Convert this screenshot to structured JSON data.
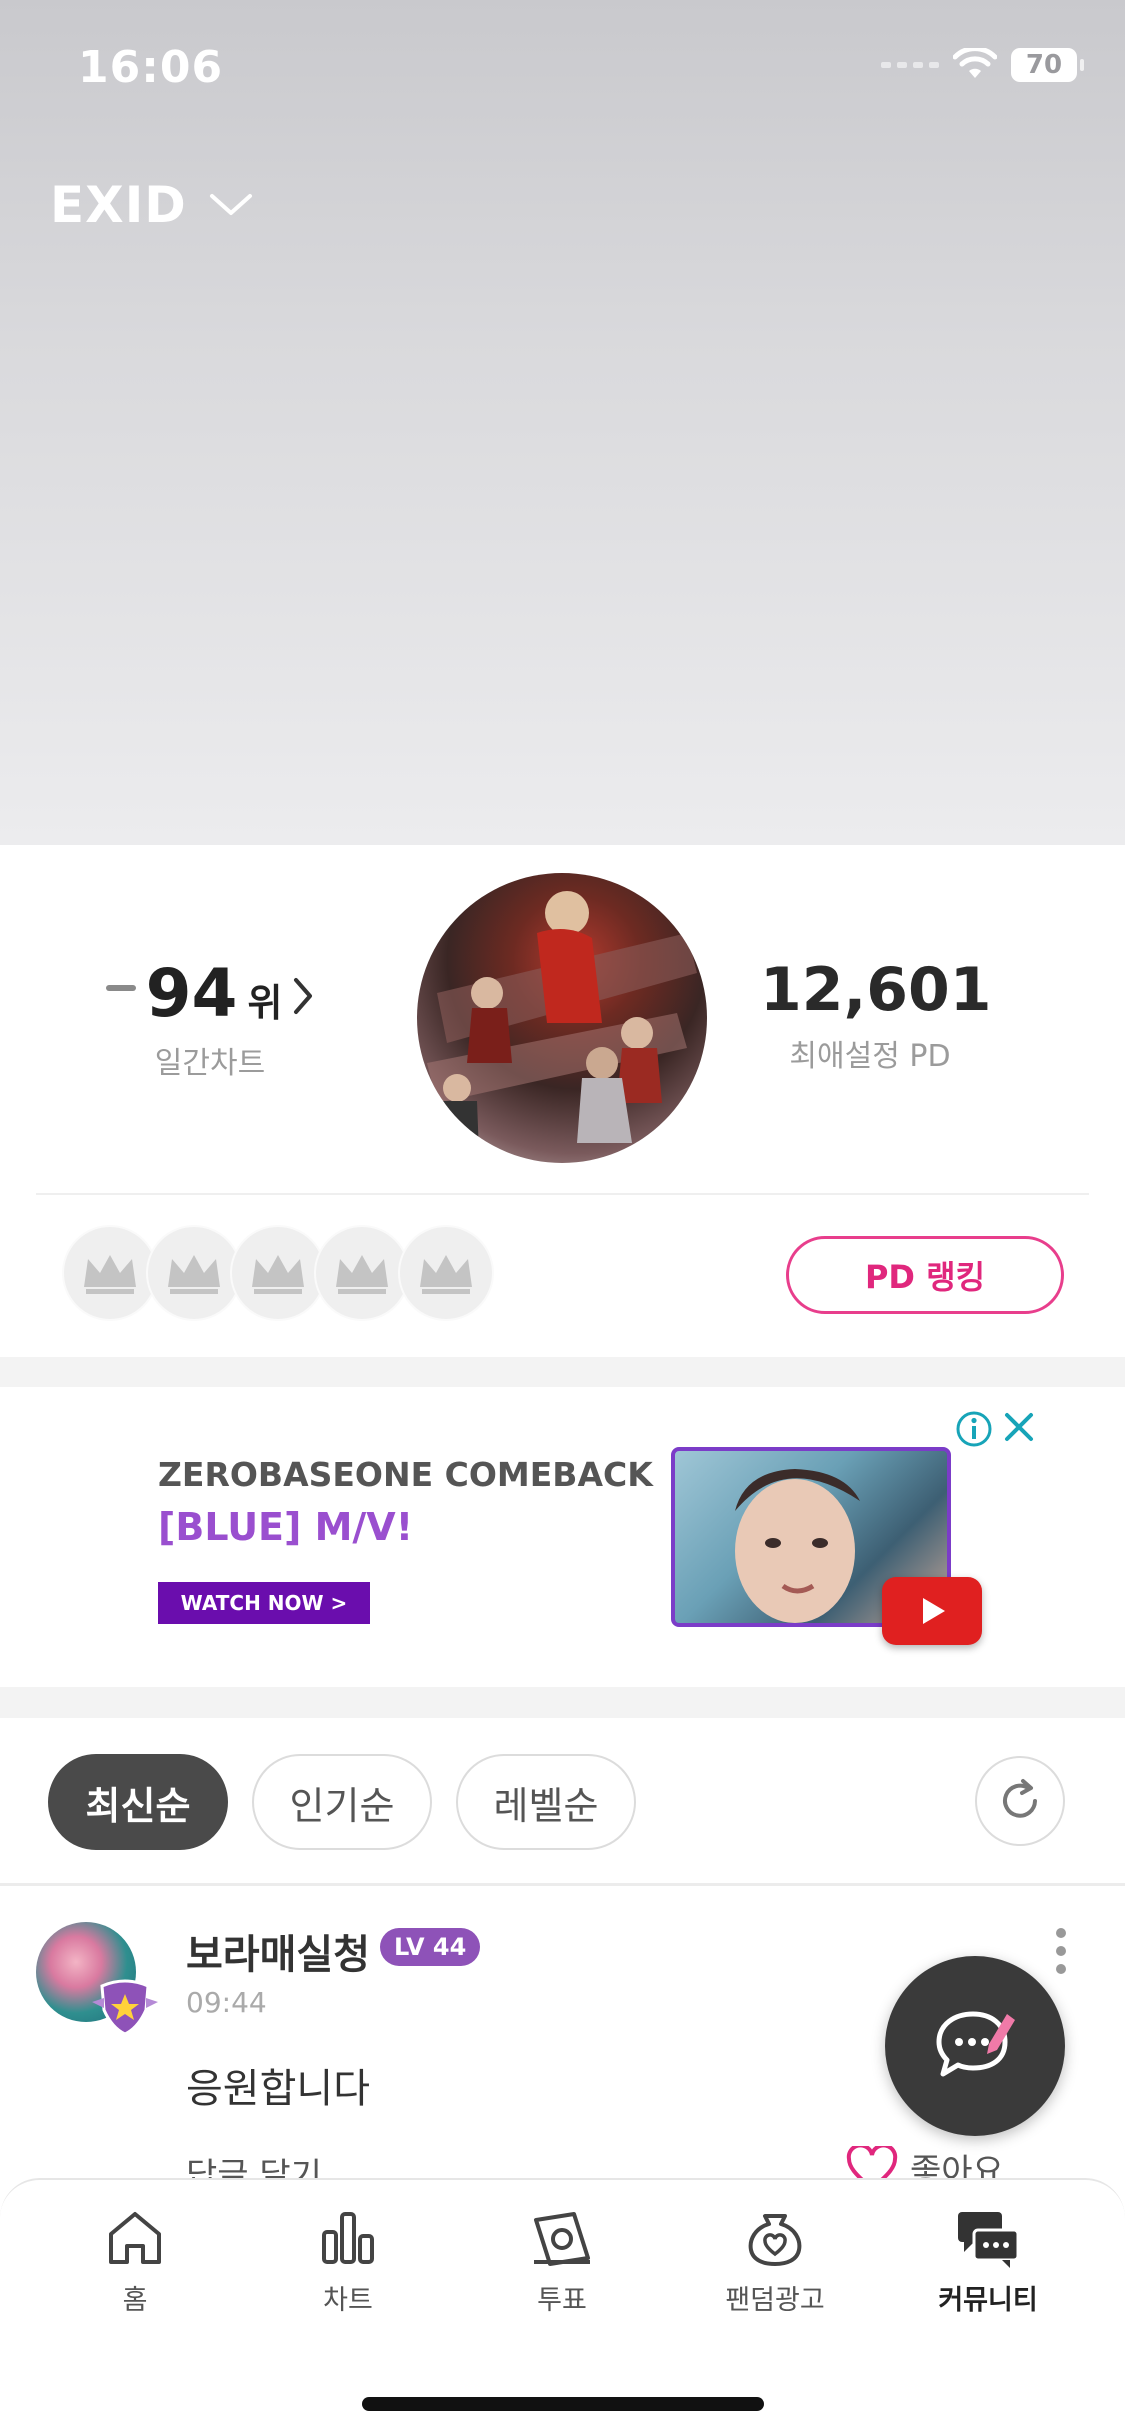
{
  "status_bar": {
    "time": "16:06",
    "battery": "70"
  },
  "header": {
    "artist_name": "EXID"
  },
  "profile": {
    "rank_value": "94",
    "rank_unit": "위",
    "rank_label": "일간차트",
    "pd_count": "12,601",
    "pd_label": "최애설정 PD",
    "pd_ranking_button": "PD 랭킹"
  },
  "ad": {
    "title": "ZEROBASEONE COMEBACK",
    "subtitle": "[BLUE] M/V!",
    "cta": "WATCH NOW >"
  },
  "sort": {
    "options": [
      "최신순",
      "인기순",
      "레벨순"
    ],
    "active": "최신순"
  },
  "post": {
    "author": "보라매실청",
    "level": "LV 44",
    "time": "09:44",
    "body": "응원합니다",
    "reply_label": "답글 달기",
    "like_label": "좋아요"
  },
  "tab_bar": {
    "items": [
      {
        "label": "홈",
        "icon": "home-icon"
      },
      {
        "label": "차트",
        "icon": "chart-icon"
      },
      {
        "label": "투표",
        "icon": "vote-icon"
      },
      {
        "label": "팬덤광고",
        "icon": "fandom-ad-icon"
      },
      {
        "label": "커뮤니티",
        "icon": "community-icon"
      }
    ],
    "active": "커뮤니티"
  },
  "colors": {
    "accent": "#e0277d",
    "level_badge": "#8e52b8",
    "dark_chip": "#4a4a4a"
  }
}
